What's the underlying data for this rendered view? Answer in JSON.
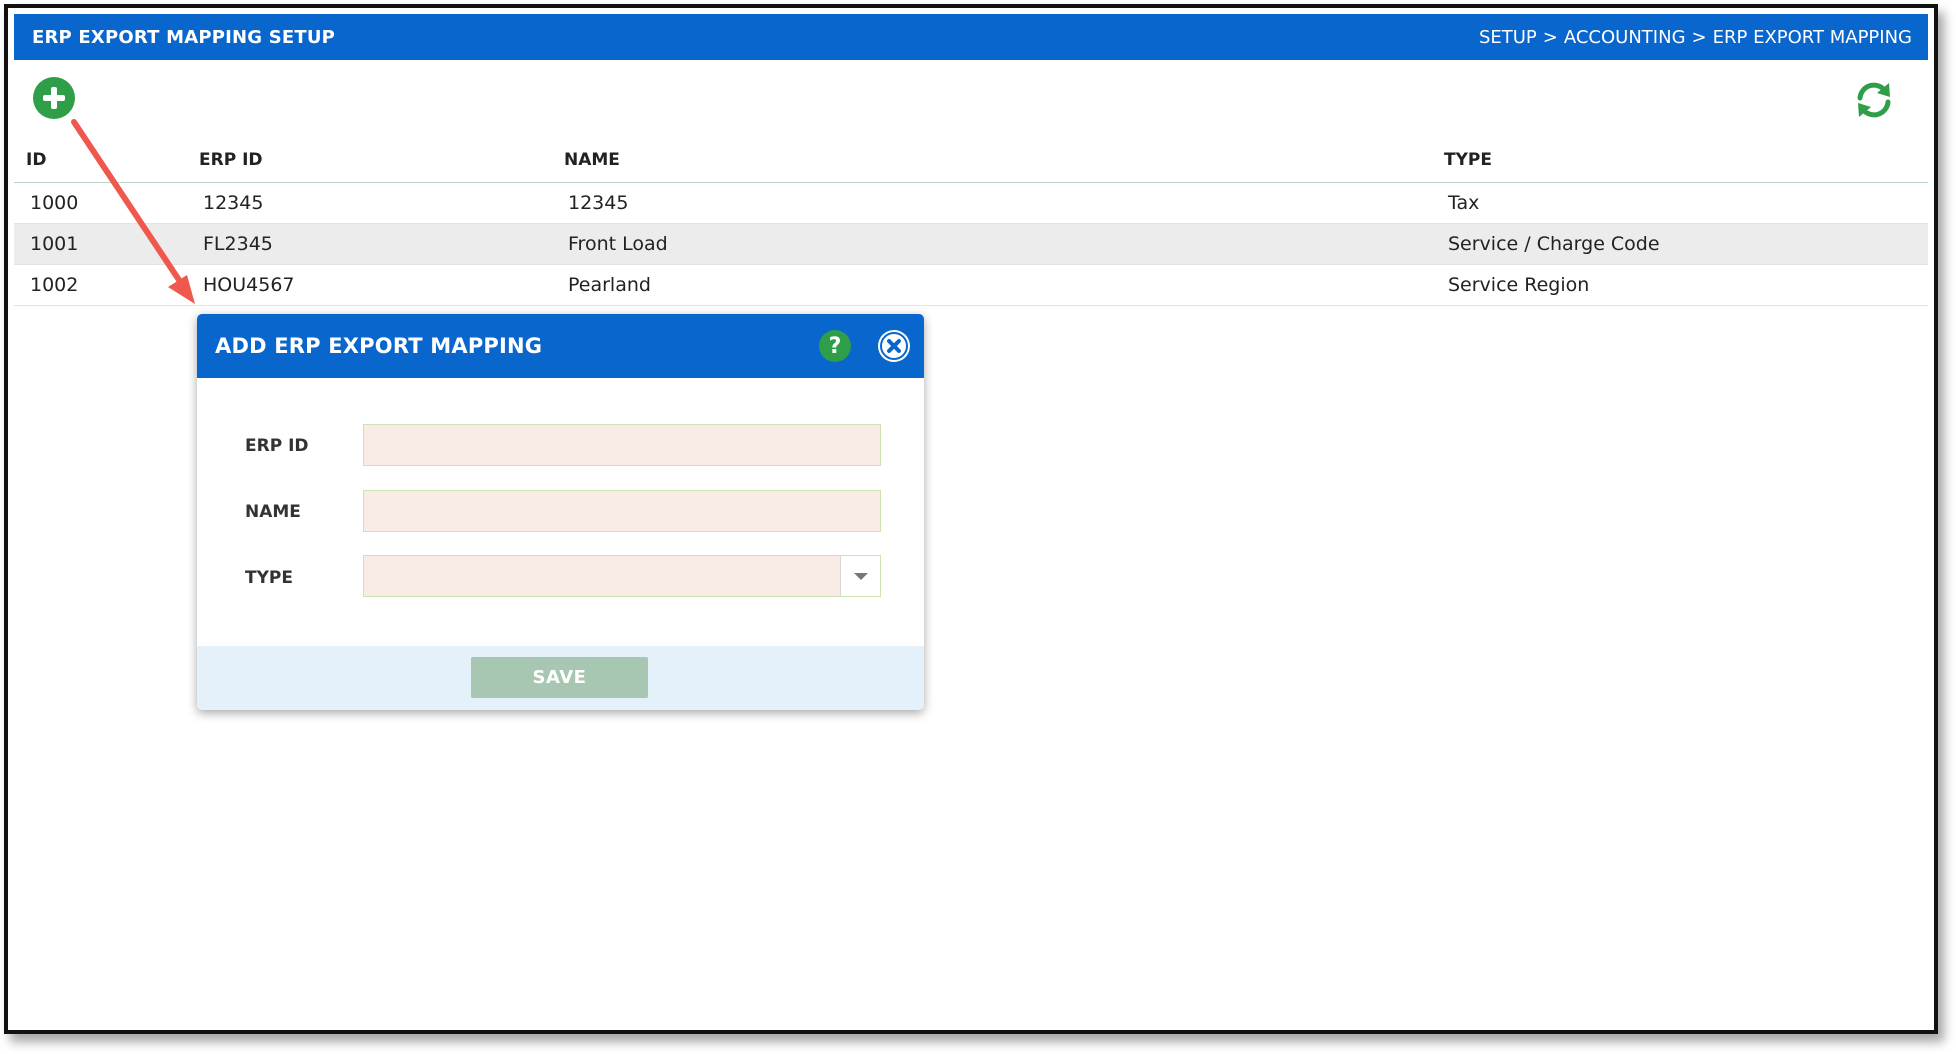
{
  "header": {
    "title": "ERP EXPORT MAPPING SETUP",
    "breadcrumb": [
      "SETUP",
      ">",
      "ACCOUNTING",
      ">",
      "ERP EXPORT MAPPING"
    ]
  },
  "toolbar": {
    "add_icon": "plus-circle-icon",
    "refresh_icon": "refresh-icon"
  },
  "grid": {
    "columns": [
      "ID",
      "ERP ID",
      "NAME",
      "TYPE"
    ],
    "rows": [
      {
        "id": "1000",
        "erp_id": "12345",
        "name": "12345",
        "type": "Tax"
      },
      {
        "id": "1001",
        "erp_id": "FL2345",
        "name": "Front Load",
        "type": "Service / Charge Code"
      },
      {
        "id": "1002",
        "erp_id": "HOU4567",
        "name": "Pearland",
        "type": "Service Region"
      }
    ]
  },
  "dialog": {
    "title": "ADD ERP EXPORT MAPPING",
    "help_label": "?",
    "fields": {
      "erp_id_label": "ERP ID",
      "erp_id_value": "",
      "name_label": "NAME",
      "name_value": "",
      "type_label": "TYPE",
      "type_value": ""
    },
    "save_label": "SAVE"
  },
  "colors": {
    "header_blue": "#0866cc",
    "add_green": "#2e9e48",
    "save_disabled": "#a7c7b2",
    "input_bg": "#f9ece6",
    "annotation_arrow": "#f0584d"
  }
}
